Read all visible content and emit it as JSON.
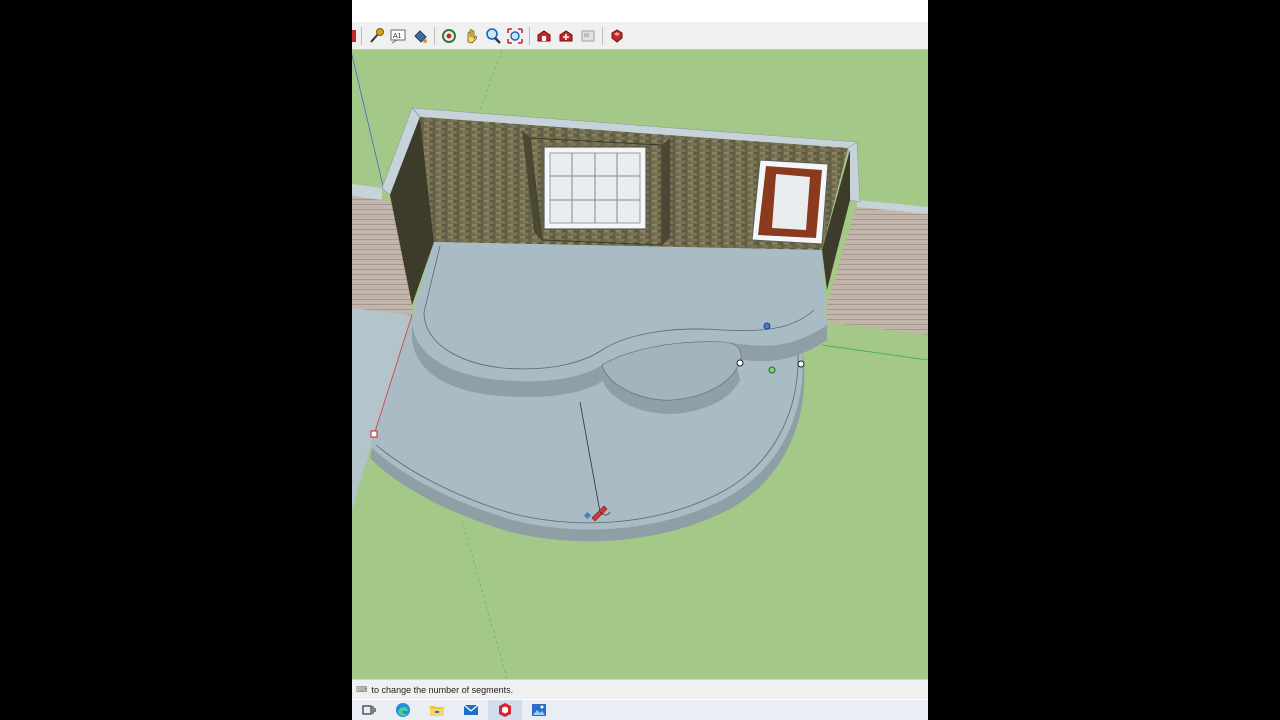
{
  "window": {
    "title": ""
  },
  "toolbar": {
    "tools": [
      {
        "name": "partial-tool-icon",
        "color": "#c62828"
      },
      {
        "name": "tape-measure-icon",
        "color": "#d4a017"
      },
      {
        "name": "text-tool-icon",
        "color": "#555555"
      },
      {
        "name": "paint-bucket-icon",
        "color": "#3a6ea8"
      },
      {
        "name": "orbit-icon",
        "color": "#2e7d32"
      },
      {
        "name": "pan-icon",
        "color": "#d4a017"
      },
      {
        "name": "zoom-icon",
        "color": "#1565c0"
      },
      {
        "name": "zoom-extents-icon",
        "color": "#1565c0"
      },
      {
        "name": "warehouse-icon",
        "color": "#c62828"
      },
      {
        "name": "extension-warehouse-icon",
        "color": "#c62828"
      },
      {
        "name": "layout-icon",
        "color": "#9e9e9e"
      },
      {
        "name": "ruby-console-icon",
        "color": "#c62828"
      }
    ]
  },
  "status": {
    "icon": "status-hint-icon",
    "text": "to change the number of segments."
  },
  "taskbar": {
    "items": [
      {
        "name": "task-view-icon"
      },
      {
        "name": "edge-browser-icon"
      },
      {
        "name": "file-explorer-icon"
      },
      {
        "name": "mail-icon"
      },
      {
        "name": "sketchup-app-icon",
        "active": true
      },
      {
        "name": "photos-icon"
      }
    ]
  },
  "colors": {
    "ground": "#a3c888",
    "patio": "#a9bbc4",
    "wall_cap": "#c6d3d9",
    "brick": "#6e6a4e",
    "siding": "#b8a8a0",
    "door": "#8b3a1e",
    "window_glass": "#e8eef0"
  }
}
